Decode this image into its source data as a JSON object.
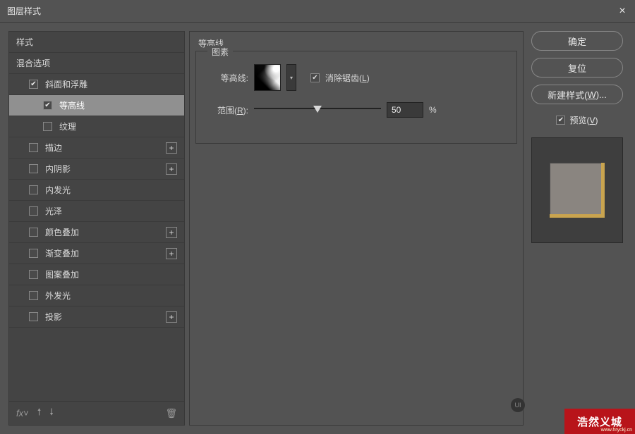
{
  "window": {
    "title": "图层样式"
  },
  "sidebar": {
    "header_styles": "样式",
    "header_blend": "混合选项",
    "items": [
      {
        "label": "斜面和浮雕",
        "checked": true,
        "addable": false,
        "level": 1
      },
      {
        "label": "等高线",
        "checked": true,
        "addable": false,
        "level": 2,
        "selected": true
      },
      {
        "label": "纹理",
        "checked": false,
        "addable": false,
        "level": 2
      },
      {
        "label": "描边",
        "checked": false,
        "addable": true,
        "level": 1
      },
      {
        "label": "内阴影",
        "checked": false,
        "addable": true,
        "level": 1
      },
      {
        "label": "内发光",
        "checked": false,
        "addable": false,
        "level": 1
      },
      {
        "label": "光泽",
        "checked": false,
        "addable": false,
        "level": 1
      },
      {
        "label": "颜色叠加",
        "checked": false,
        "addable": true,
        "level": 1
      },
      {
        "label": "渐变叠加",
        "checked": false,
        "addable": true,
        "level": 1
      },
      {
        "label": "图案叠加",
        "checked": false,
        "addable": false,
        "level": 1
      },
      {
        "label": "外发光",
        "checked": false,
        "addable": false,
        "level": 1
      },
      {
        "label": "投影",
        "checked": false,
        "addable": true,
        "level": 1
      }
    ]
  },
  "main": {
    "title": "等高线",
    "fieldset_label": "图素",
    "contour_label": "等高线:",
    "antialias_label_pre": "消除锯齿(",
    "antialias_key": "L",
    "antialias_label_post": ")",
    "antialias_checked": true,
    "range_label_pre": "范围(",
    "range_key": "R",
    "range_label_post": "):",
    "range_value": "50",
    "range_unit": "%"
  },
  "right": {
    "ok": "确定",
    "reset": "复位",
    "new_style_pre": "新建样式(",
    "new_style_key": "W",
    "new_style_post": ")...",
    "preview_pre": "预览(",
    "preview_key": "V",
    "preview_post": ")",
    "preview_checked": true
  },
  "footer": {
    "logo_text": "UI",
    "brand": "浩然义城",
    "url": "www.hryckj.cn"
  }
}
